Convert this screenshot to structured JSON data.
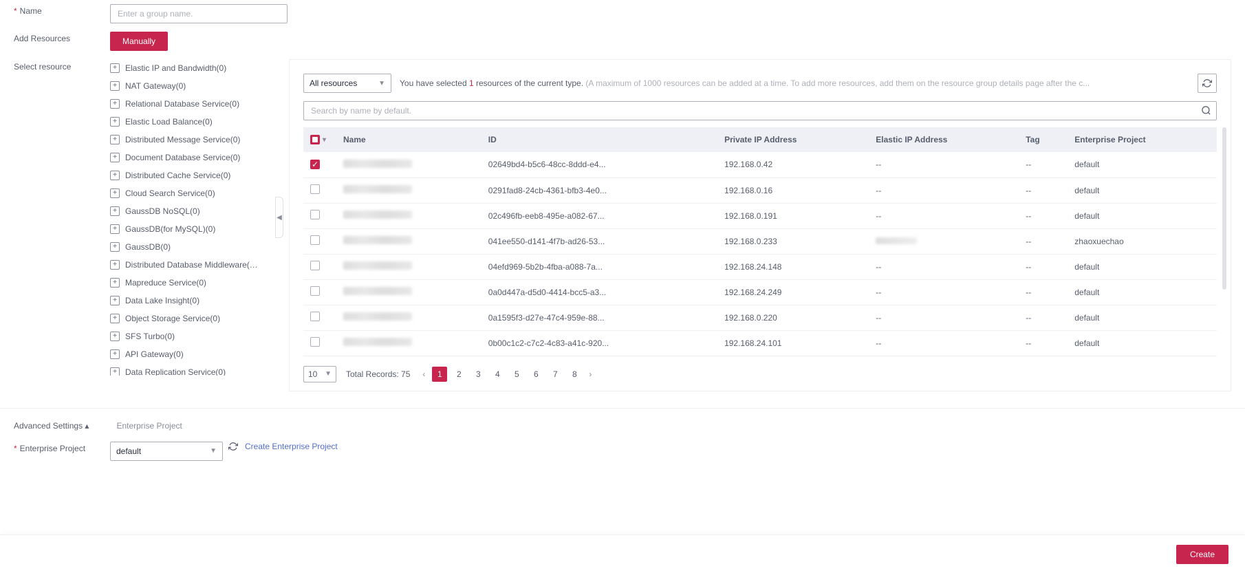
{
  "form": {
    "name_label": "Name",
    "name_placeholder": "Enter a group name.",
    "add_resources_label": "Add Resources",
    "manually_btn": "Manually",
    "select_resource_label": "Select resource"
  },
  "tree": {
    "items": [
      {
        "label": "Elastic IP and Bandwidth(0)"
      },
      {
        "label": "NAT Gateway(0)"
      },
      {
        "label": "Relational Database Service(0)"
      },
      {
        "label": "Elastic Load Balance(0)"
      },
      {
        "label": "Distributed Message Service(0)"
      },
      {
        "label": "Document Database Service(0)"
      },
      {
        "label": "Distributed Cache Service(0)"
      },
      {
        "label": "Cloud Search Service(0)"
      },
      {
        "label": "GaussDB NoSQL(0)"
      },
      {
        "label": "GaussDB(for MySQL)(0)"
      },
      {
        "label": "GaussDB(0)"
      },
      {
        "label": "Distributed Database Middleware(ne..."
      },
      {
        "label": "Mapreduce Service(0)"
      },
      {
        "label": "Data Lake Insight(0)"
      },
      {
        "label": "Object Storage Service(0)"
      },
      {
        "label": "SFS Turbo(0)"
      },
      {
        "label": "API Gateway(0)"
      },
      {
        "label": "Data Replication Service(0)"
      }
    ]
  },
  "filter": {
    "all_resources": "All resources",
    "selected_prefix": "You have selected ",
    "selected_count": "1",
    "selected_suffix": " resources of the current type. ",
    "hint": "(A maximum of 1000 resources can be added at a time. To add more resources, add them on the resource group details page after the c...",
    "search_placeholder": "Search by name by default."
  },
  "table": {
    "headers": {
      "name": "Name",
      "id": "ID",
      "private_ip": "Private IP Address",
      "elastic_ip": "Elastic IP Address",
      "tag": "Tag",
      "enterprise": "Enterprise Project"
    },
    "rows": [
      {
        "checked": true,
        "id": "02649bd4-b5c6-48cc-8ddd-e4...",
        "private_ip": "192.168.0.42",
        "elastic_ip": "--",
        "tag": "--",
        "enterprise": "default"
      },
      {
        "checked": false,
        "id": "0291fad8-24cb-4361-bfb3-4e0...",
        "private_ip": "192.168.0.16",
        "elastic_ip": "--",
        "tag": "--",
        "enterprise": "default"
      },
      {
        "checked": false,
        "id": "02c496fb-eeb8-495e-a082-67...",
        "private_ip": "192.168.0.191",
        "elastic_ip": "--",
        "tag": "--",
        "enterprise": "default"
      },
      {
        "checked": false,
        "id": "041ee550-d141-4f7b-ad26-53...",
        "private_ip": "192.168.0.233",
        "elastic_ip": "@eip",
        "tag": "--",
        "enterprise": "zhaoxuechao"
      },
      {
        "checked": false,
        "id": "04efd969-5b2b-4fba-a088-7a...",
        "private_ip": "192.168.24.148",
        "elastic_ip": "--",
        "tag": "--",
        "enterprise": "default"
      },
      {
        "checked": false,
        "id": "0a0d447a-d5d0-4414-bcc5-a3...",
        "private_ip": "192.168.24.249",
        "elastic_ip": "--",
        "tag": "--",
        "enterprise": "default"
      },
      {
        "checked": false,
        "id": "0a1595f3-d27e-47c4-959e-88...",
        "private_ip": "192.168.0.220",
        "elastic_ip": "--",
        "tag": "--",
        "enterprise": "default"
      },
      {
        "checked": false,
        "id": "0b00c1c2-c7c2-4c83-a41c-920...",
        "private_ip": "192.168.24.101",
        "elastic_ip": "--",
        "tag": "--",
        "enterprise": "default"
      }
    ]
  },
  "pagination": {
    "page_size": "10",
    "total_label": "Total Records: 75",
    "pages": [
      "1",
      "2",
      "3",
      "4",
      "5",
      "6",
      "7",
      "8"
    ]
  },
  "advanced": {
    "toggle": "Advanced Settings",
    "sublabel": "Enterprise Project",
    "ep_label": "Enterprise Project",
    "ep_value": "default",
    "create_link": "Create Enterprise Project"
  },
  "footer": {
    "create": "Create"
  }
}
